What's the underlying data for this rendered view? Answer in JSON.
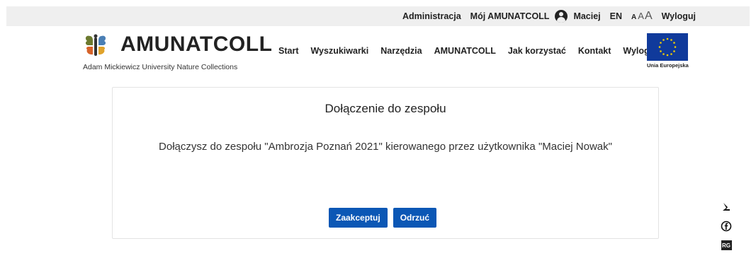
{
  "topbar": {
    "admin": "Administracja",
    "my_account": "Mój AMUNATCOLL",
    "user_name": "Maciej",
    "language": "EN",
    "font_small": "A",
    "font_medium": "A",
    "font_large": "A",
    "logout": "Wyloguj"
  },
  "logo": {
    "title": "AMUNATCOLL",
    "subtitle": "Adam Mickiewicz University Nature Collections"
  },
  "nav": {
    "items": [
      "Start",
      "Wyszukiwarki",
      "Narzędzia",
      "AMUNATCOLL",
      "Jak korzystać",
      "Kontakt",
      "Wyloguj"
    ]
  },
  "eu": {
    "label": "Unia Europejska",
    "flag_color": "#103a9b",
    "star_color": "#f5d000"
  },
  "dialog": {
    "title": "Dołączenie do zespołu",
    "message": "Dołączysz do zespołu \"Ambrozja Poznań 2021\" kierowanego przez użytkownika \"Maciej Nowak\"",
    "accept": "Zaakceptuj",
    "reject": "Odrzuć"
  },
  "side_icons": [
    "orcid-icon",
    "facebook-icon",
    "researchgate-icon"
  ],
  "side_badge": "RG",
  "colors": {
    "accent": "#0b57b5",
    "topbar_bg": "#efefef"
  }
}
